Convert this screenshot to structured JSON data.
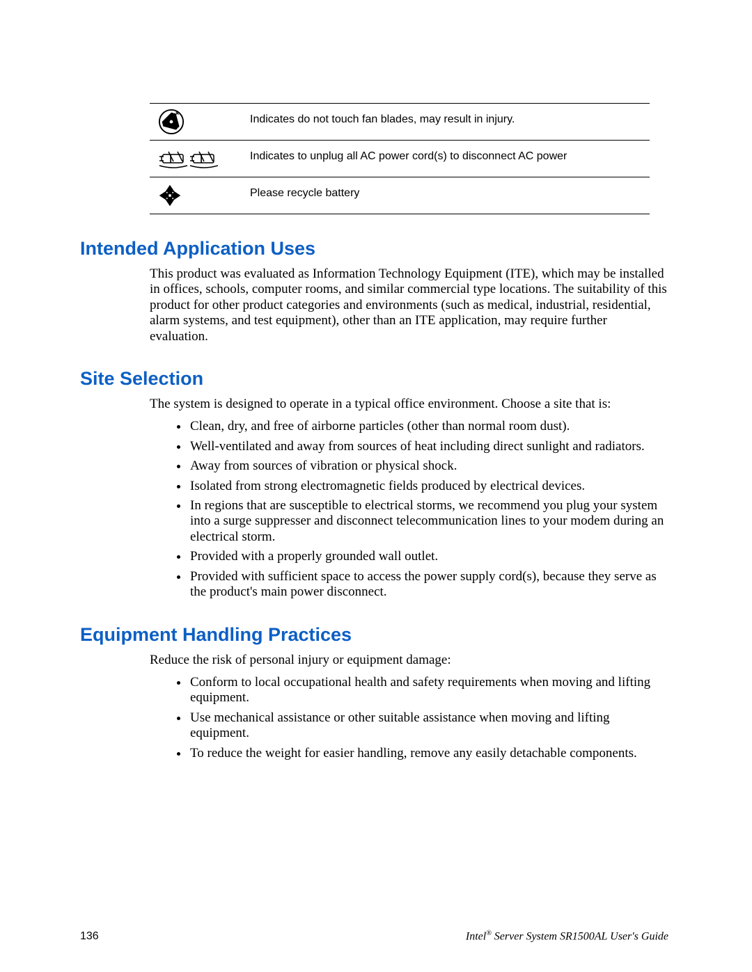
{
  "table": {
    "rows": [
      {
        "icon": "fan-hazard-icon",
        "desc": "Indicates do not touch fan blades, may result in injury."
      },
      {
        "icon": "unplug-power-icon",
        "desc": "Indicates to unplug all AC power cord(s) to disconnect AC power"
      },
      {
        "icon": "recycle-icon",
        "desc": "Please recycle battery"
      }
    ]
  },
  "sections": {
    "intended": {
      "title": "Intended Application Uses",
      "para": "This product was evaluated as Information Technology Equipment (ITE), which may be installed in offices, schools, computer rooms, and similar commercial type locations.  The suitability of this product for other product categories and environments (such as medical, industrial, residential, alarm systems, and test equipment), other than an ITE application, may require further evaluation."
    },
    "site": {
      "title": "Site Selection",
      "para": "The system is designed to operate in a typical office environment.  Choose a site that is:",
      "bullets": [
        "Clean, dry, and free of airborne particles (other than normal room dust).",
        "Well-ventilated and away from sources of heat including direct sunlight and radiators.",
        "Away from sources of vibration or physical shock.",
        "Isolated from strong electromagnetic fields produced by electrical devices.",
        "In regions that are susceptible to electrical storms, we recommend you plug your system into a surge suppresser and disconnect telecommunication lines to your modem during an electrical storm.",
        "Provided with a properly grounded wall outlet.",
        "Provided with sufficient space to access the power supply cord(s), because they serve as the product's main power disconnect."
      ]
    },
    "equip": {
      "title": "Equipment Handling Practices",
      "para": "Reduce the risk of personal injury or equipment damage:",
      "bullets": [
        "Conform to local occupational health and safety requirements when moving and lifting equipment.",
        "Use mechanical assistance or other suitable assistance when moving and lifting equipment.",
        "To reduce the weight for easier handling, remove any easily detachable components."
      ]
    }
  },
  "footer": {
    "page": "136",
    "brand": "Intel",
    "reg": "®",
    "title_rest": " Server System SR1500AL User's Guide"
  }
}
